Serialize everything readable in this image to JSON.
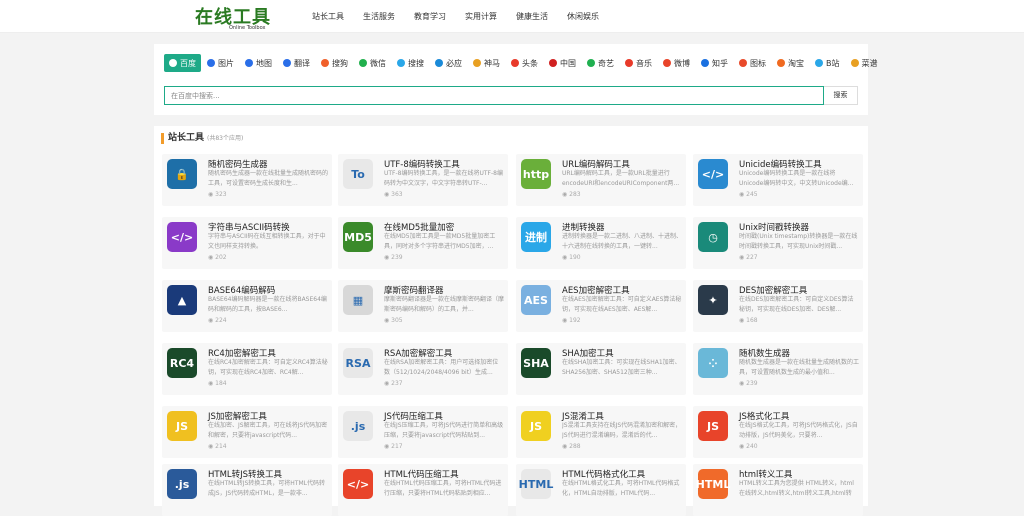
{
  "header": {
    "logo_text": "在线工具",
    "logo_sub": "Online Toolbox",
    "nav": [
      "站长工具",
      "生活服务",
      "教育学习",
      "实用计算",
      "健康生活",
      "休闲娱乐"
    ]
  },
  "search": {
    "engines": [
      {
        "label": "百度",
        "color": "#2a6ee8"
      },
      {
        "label": "图片",
        "color": "#2a6ee8"
      },
      {
        "label": "地图",
        "color": "#2a6ee8"
      },
      {
        "label": "翻译",
        "color": "#2a6ee8"
      },
      {
        "label": "搜狗",
        "color": "#f0602a"
      },
      {
        "label": "微信",
        "color": "#21b04d"
      },
      {
        "label": "搜搜",
        "color": "#2aa7e8"
      },
      {
        "label": "必应",
        "color": "#1a8ad8"
      },
      {
        "label": "神马",
        "color": "#e8a022"
      },
      {
        "label": "头条",
        "color": "#e83a2a"
      },
      {
        "label": "中国",
        "color": "#d02020"
      },
      {
        "label": "奇艺",
        "color": "#20b050"
      },
      {
        "label": "音乐",
        "color": "#e83a2a"
      },
      {
        "label": "微博",
        "color": "#e8442a"
      },
      {
        "label": "知乎",
        "color": "#1a70e0"
      },
      {
        "label": "图标",
        "color": "#e84a2a"
      },
      {
        "label": "淘宝",
        "color": "#f06a20"
      },
      {
        "label": "B站",
        "color": "#2aa7e8"
      },
      {
        "label": "菜谱",
        "color": "#e8a022"
      }
    ],
    "placeholder": "在百度中搜索...",
    "button": "搜索"
  },
  "section": {
    "title": "站长工具",
    "count": "(共83个应用)"
  },
  "tools": [
    {
      "name": "随机密码生成器",
      "desc": "随机密码生成器一款在线批量生成随机密码的工具，可设置密码生成长度和生...",
      "views": "323",
      "icon": "🔒",
      "bg": "#1e6fa8"
    },
    {
      "name": "UTF-8编码转换工具",
      "desc": "UTF-8编码转换工具，是一款在线将UTF-8编码转为中文汉字，中文字符串转UTF-...",
      "views": "363",
      "icon": "To",
      "bg": "#e8e8e8"
    },
    {
      "name": "URL编码解码工具",
      "desc": "URL编码解码工具，是一款URL批量进行encodeURI和encodeURIComponent两...",
      "views": "283",
      "icon": "http",
      "bg": "#6aaf3a"
    },
    {
      "name": "Unicide编码转换工具",
      "desc": "Unicode编码转换工具是一款在线将Unicode编码转中文，中文转Unicode编...",
      "views": "245",
      "icon": "</>",
      "bg": "#2a8ad0"
    },
    {
      "name": "字符串与ASCII码转换",
      "desc": "字符串与ASCII码在线互相转换工具，对于中文也同样支持转换。",
      "views": "202",
      "icon": "</>",
      "bg": "#8a3ac8"
    },
    {
      "name": "在线MD5批量加密",
      "desc": "在线MD5加密工具是一款MD5批量加密工具，同时对多个字符串进行MD5加密，...",
      "views": "239",
      "icon": "MD5",
      "bg": "#3a8a2a"
    },
    {
      "name": "进制转换器",
      "desc": "进制转换器是一款二进制、八进制、十进制、十六进制在线转换的工具，一键转...",
      "views": "190",
      "icon": "进制",
      "bg": "#2aa7e8"
    },
    {
      "name": "Unix时间戳转换器",
      "desc": "时间戳(Unix timestamp)转换器是一款在线时间戳转换工具，可实现Unix时间戳...",
      "views": "227",
      "icon": "◷",
      "bg": "#1a8a7a"
    },
    {
      "name": "BASE64编码解码",
      "desc": "BASE64编码解码器是一款在线将BASE64编码和解码的工具，按BASE6...",
      "views": "224",
      "icon": "▲",
      "bg": "#1a3a7a"
    },
    {
      "name": "摩斯密码翻译器",
      "desc": "摩斯密码翻译器是一款在线摩斯密码翻译（摩斯密码编码和解码）的工具，并...",
      "views": "305",
      "icon": "▦",
      "bg": "#d8d8d8"
    },
    {
      "name": "AES加密解密工具",
      "desc": "在线AES加密解密工具：可自定义AES算法秘钥，可实现在线AES加密、AES解...",
      "views": "192",
      "icon": "AES",
      "bg": "#7ab0e0"
    },
    {
      "name": "DES加密解密工具",
      "desc": "在线DES加密解密工具：可自定义DES算法秘钥，可实现在线DES加密、DES解...",
      "views": "168",
      "icon": "✦",
      "bg": "#2a3a4a"
    },
    {
      "name": "RC4加密解密工具",
      "desc": "在线RC4加密解密工具：可自定义RC4算法秘钥，可实现在线RC4加密、RC4解...",
      "views": "184",
      "icon": "RC4",
      "bg": "#1a4a2a"
    },
    {
      "name": "RSA加密解密工具",
      "desc": "在线RSA加密解密工具：用户可选择加密位数（512/1024/2048/4096 bit）生成...",
      "views": "237",
      "icon": "RSA",
      "bg": "#e8e8e8"
    },
    {
      "name": "SHA加密工具",
      "desc": "在线SHA加密工具：可实现在线SHA1加密、SHA256加密、SHA512加密三种...",
      "views": "",
      "icon": "SHA",
      "bg": "#1a4a2a"
    },
    {
      "name": "随机数生成器",
      "desc": "随机数生成器是一款在线批量生成随机数的工具，可设置随机数生成的最小值和...",
      "views": "239",
      "icon": "⁘",
      "bg": "#6ab8d8"
    },
    {
      "name": "JS加密解密工具",
      "desc": "在线加密、JS解密工具，可在线将JS代码加密和解密，只要将javascript代码...",
      "views": "214",
      "icon": "JS",
      "bg": "#f0c020"
    },
    {
      "name": "JS代码压缩工具",
      "desc": "在线JS压缩工具，可将JS代码进行简单和高级压缩，只要将javascript代码粘贴到...",
      "views": "217",
      "icon": ".js",
      "bg": "#e8e8e8"
    },
    {
      "name": "JS混淆工具",
      "desc": "JS混淆工具支持在线JS代码混淆加密和解密，JS代码进行混淆编码，混淆后的代...",
      "views": "288",
      "icon": "JS",
      "bg": "#f0d020"
    },
    {
      "name": "JS格式化工具",
      "desc": "在线JS格式化工具，可将JS代码格式化，JS自动排版，JS代码美化，只要将...",
      "views": "240",
      "icon": "JS",
      "bg": "#e8442a"
    },
    {
      "name": "HTML转JS转换工具",
      "desc": "在线HTML转JS转换工具，可将HTML代码转成JS，JS代码转成HTML，是一款非...",
      "views": "",
      "icon": ".js",
      "bg": "#2a5a9a"
    },
    {
      "name": "HTML代码压缩工具",
      "desc": "在线HTML代码压缩工具，可将HTML代码进行压缩，只要将HTML代码粘贴到相应...",
      "views": "",
      "icon": "</>",
      "bg": "#e8442a"
    },
    {
      "name": "HTML代码格式化工具",
      "desc": "在线HTML格式化工具，可将HTML代码格式化，HTML自动排版，HTML代码...",
      "views": "",
      "icon": "HTML",
      "bg": "#e8e8e8"
    },
    {
      "name": "html转义工具",
      "desc": "HTML转义工具为您提供 HTML转义，html在线转义,html转义,html转义工具,html转义...",
      "views": "",
      "icon": "HTML",
      "bg": "#f06a2a"
    }
  ]
}
